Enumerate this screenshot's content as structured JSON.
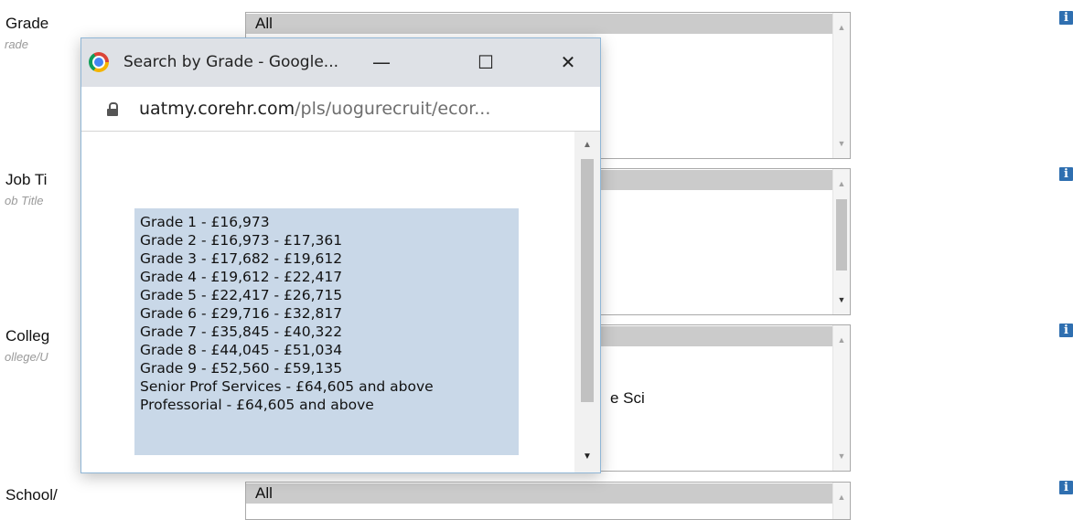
{
  "form": {
    "fields": [
      {
        "label": "Grade",
        "sub": "rade",
        "select_value": "All"
      },
      {
        "label": "Job Ti",
        "sub": "ob Title"
      },
      {
        "label": "Colleg",
        "sub": "ollege/U",
        "partial_text": "e Sci"
      },
      {
        "label": "School/",
        "select_value": "All"
      }
    ]
  },
  "popup": {
    "window_title": "Search by Grade - Google...",
    "minimize_glyph": "—",
    "maximize_glyph": "☐",
    "close_glyph": "✕",
    "url_host": "uatmy.corehr.com",
    "url_path": "/pls/uogurecruit/ecor...",
    "grades": [
      "Grade 1 - £16,973",
      "Grade 2 - £16,973 - £17,361",
      "Grade 3 - £17,682 - £19,612",
      "Grade 4 - £19,612 - £22,417",
      "Grade 5 - £22,417 - £26,715",
      "Grade 6 - £29,716 - £32,817",
      "Grade 7 - £35,845 - £40,322",
      "Grade 8 - £44,045 - £51,034",
      "Grade 9 - £52,560 - £59,135",
      "Senior Prof Services - £64,605 and above",
      "Professorial - £64,605 and above"
    ]
  },
  "icons": {
    "info": "info-icon",
    "lock": "lock-icon",
    "browser": "chrome-logo-icon"
  },
  "colors": {
    "info_icon": "#2f6fb0",
    "list_highlight": "#c9d8e8",
    "titlebar": "#dee1e6",
    "selected_option": "#cbcbcb"
  }
}
